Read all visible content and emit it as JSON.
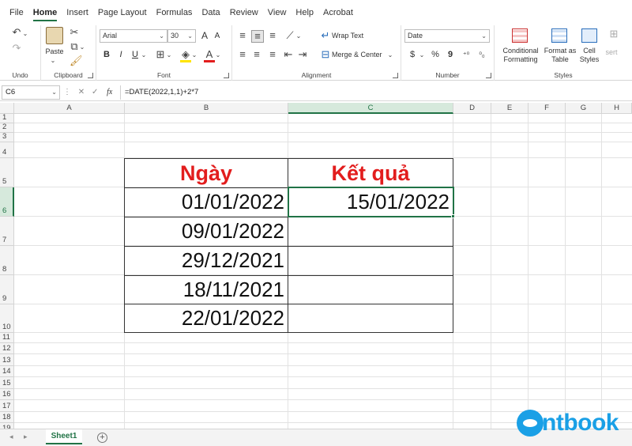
{
  "menu": {
    "tabs": [
      "File",
      "Home",
      "Insert",
      "Page Layout",
      "Formulas",
      "Data",
      "Review",
      "View",
      "Help",
      "Acrobat"
    ],
    "active": "Home"
  },
  "ribbon": {
    "undo": {
      "label": "Undo"
    },
    "clipboard": {
      "label": "Clipboard",
      "paste": "Paste"
    },
    "font": {
      "label": "Font",
      "name": "Arial",
      "size": "30",
      "bold": "B",
      "italic": "I",
      "underline": "U",
      "grow": "A",
      "shrink": "A"
    },
    "alignment": {
      "label": "Alignment",
      "wrap": "Wrap Text",
      "merge": "Merge & Center"
    },
    "number": {
      "label": "Number",
      "format": "Date",
      "currency": "$",
      "percent": "%",
      "comma": "9"
    },
    "styles": {
      "label": "Styles",
      "conditional_1": "Conditional",
      "conditional_2": "Formatting",
      "format_as_1": "Format as",
      "format_as_2": "Table",
      "cell_1": "Cell",
      "cell_2": "Styles",
      "insert_partial": "sert"
    }
  },
  "formula_bar": {
    "name_box": "C6",
    "fx": "fx",
    "formula": "=DATE(2022,1,1)+2*7"
  },
  "columns": [
    "A",
    "B",
    "C",
    "D",
    "E",
    "F",
    "G",
    "H"
  ],
  "selected_column": "C",
  "rows": [
    "1",
    "2",
    "3",
    "4",
    "5",
    "6",
    "7",
    "8",
    "9",
    "10",
    "11",
    "12",
    "13",
    "14",
    "15",
    "16",
    "17",
    "18",
    "19"
  ],
  "selected_row": "6",
  "table": {
    "header_b": "Ngày",
    "header_c": "Kết quả",
    "dates": [
      "01/01/2022",
      "09/01/2022",
      "29/12/2021",
      "18/11/2021",
      "22/01/2022"
    ],
    "results": [
      "15/01/2022",
      "",
      "",
      "",
      ""
    ],
    "header_color": "#e21d1d"
  },
  "sheets": {
    "tabs": [
      "Sheet1"
    ],
    "active": "Sheet1"
  },
  "watermark": {
    "text": "ntbook"
  },
  "colors": {
    "accent": "#217346",
    "watermark": "#1aa0e6"
  }
}
